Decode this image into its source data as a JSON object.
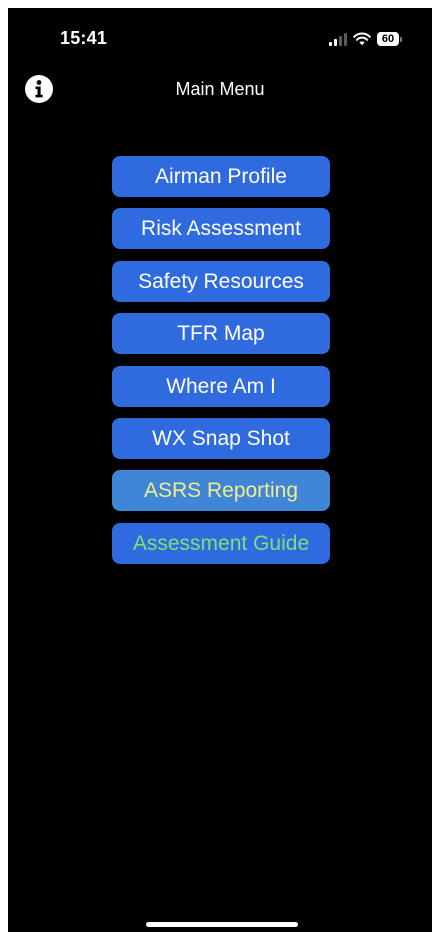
{
  "status_bar": {
    "time": "15:41",
    "battery_level": "60",
    "signal_bars_active": 2,
    "signal_bars_total": 4
  },
  "nav": {
    "title": "Main Menu",
    "info_icon": "info-icon"
  },
  "menu": {
    "items": [
      {
        "label": "Airman Profile",
        "bg": "#2f6adf",
        "fg": "#ffffff"
      },
      {
        "label": "Risk Assessment",
        "bg": "#2f6adf",
        "fg": "#ffffff"
      },
      {
        "label": "Safety Resources",
        "bg": "#2f6adf",
        "fg": "#ffffff"
      },
      {
        "label": "TFR Map",
        "bg": "#2f6adf",
        "fg": "#ffffff"
      },
      {
        "label": "Where Am I",
        "bg": "#2f6adf",
        "fg": "#ffffff"
      },
      {
        "label": "WX Snap Shot",
        "bg": "#2f6adf",
        "fg": "#ffffff"
      },
      {
        "label": "ASRS Reporting",
        "bg": "#3f86d9",
        "fg": "#f3ec8a"
      },
      {
        "label": "Assessment Guide",
        "bg": "#2f6adf",
        "fg": "#7ee07a"
      }
    ]
  },
  "colors": {
    "screen_bg": "#000000",
    "text": "#ffffff"
  }
}
